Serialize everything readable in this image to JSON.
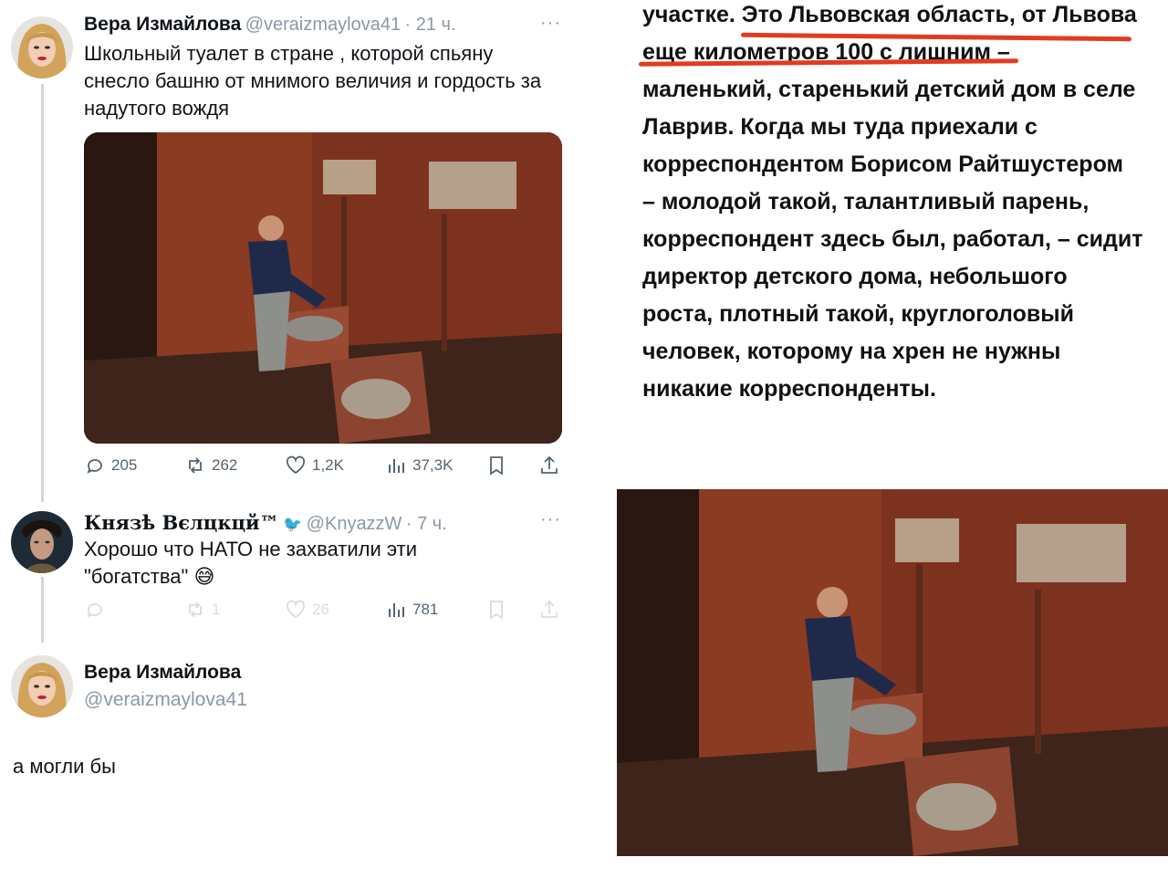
{
  "thread": {
    "tweet1": {
      "author_name": "Вера Измайлова",
      "author_handle": "@veraizmaylova41",
      "time": "· 21 ч.",
      "more_icon": "more-dots-icon",
      "text": "Школьный туалет в стране , которой спьяну снесло башню от мнимого величия и гордость за надутого вождя",
      "stats": {
        "replies": "205",
        "retweets": "262",
        "likes": "1,2K",
        "views": "37,3K"
      }
    },
    "tweet2": {
      "author_name": "Князѣ Вєлцкцй™",
      "author_handle": "@KnyazzW",
      "time": "· 7 ч.",
      "text": "Хорошо что НАТО не захватили эти \"богатства\" 😅",
      "stats": {
        "replies": "",
        "retweets": "1",
        "likes": "26",
        "views": "781"
      }
    },
    "reply_draft": {
      "author_name": "Вера Измайлова",
      "author_handle": "@veraizmaylova41",
      "text": "а могли бы"
    }
  },
  "article": {
    "lines": [
      "участке. Это Львовская область, от Львова",
      "еще километров 100 с лишним –",
      "маленький, старенький детский дом в селе",
      "Лаврив. Когда мы туда приехали с",
      "корреспондентом Борисом Райтшустером",
      "– молодой такой, талантливый парень,",
      "корреспондент здесь был, работал, – сидит",
      "директор детского дома, небольшого",
      "роста, плотный такой, круглоголовый",
      "человек, которому на хрен не нужны",
      "никакие корреспонденты."
    ],
    "underline_color": "#e23b1f"
  },
  "colors": {
    "text": "#0f1419",
    "secondary": "#536471",
    "handle": "#8b98a5",
    "thread_line": "#cfd9de"
  }
}
